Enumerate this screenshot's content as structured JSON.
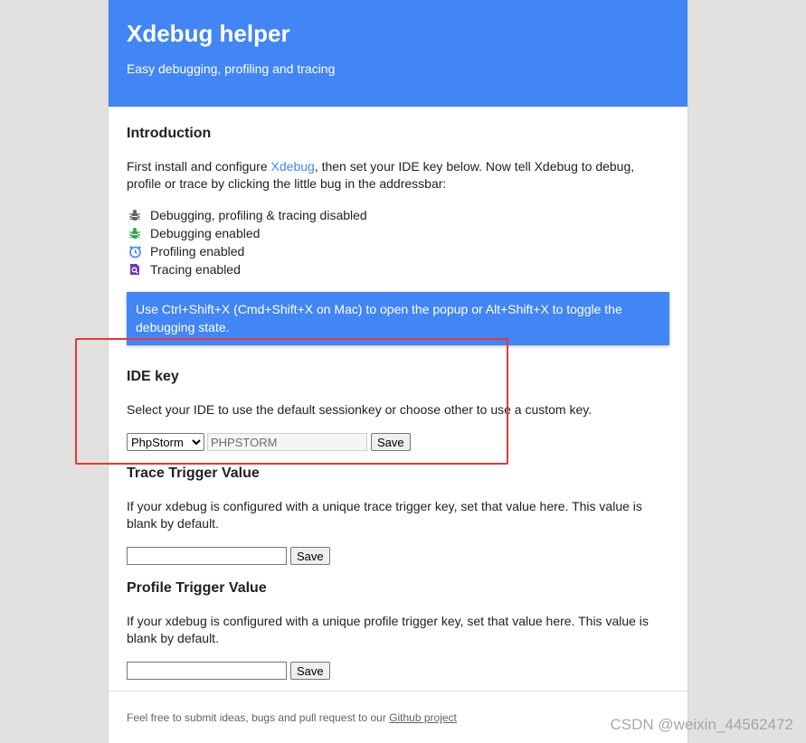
{
  "header": {
    "title": "Xdebug helper",
    "subtitle": "Easy debugging, profiling and tracing"
  },
  "intro": {
    "heading": "Introduction",
    "text_before_link": "First install and configure ",
    "link_text": "Xdebug",
    "text_after_link": ", then set your IDE key below. Now tell Xdebug to debug, profile or trace by clicking the little bug in the addressbar:",
    "legend": [
      {
        "icon": "bug-gray-icon",
        "color": "#5f6368",
        "label": "Debugging, profiling & tracing disabled"
      },
      {
        "icon": "bug-green-icon",
        "color": "#34a853",
        "label": "Debugging enabled"
      },
      {
        "icon": "clock-blue-icon",
        "color": "#4285f4",
        "label": "Profiling enabled"
      },
      {
        "icon": "trace-purple-icon",
        "color": "#673ab7",
        "label": "Tracing enabled"
      }
    ],
    "tip": "Use Ctrl+Shift+X (Cmd+Shift+X on Mac) to open the popup or Alt+Shift+X to toggle the debugging state."
  },
  "ide": {
    "heading": "IDE key",
    "description": "Select your IDE to use the default sessionkey or choose other to use a custom key.",
    "selected": "PhpStorm",
    "key_value": "PHPSTORM",
    "save_label": "Save"
  },
  "trace": {
    "heading": "Trace Trigger Value",
    "description": "If your xdebug is configured with a unique trace trigger key, set that value here. This value is blank by default.",
    "value": "",
    "save_label": "Save"
  },
  "profile": {
    "heading": "Profile Trigger Value",
    "description": "If your xdebug is configured with a unique profile trigger key, set that value here. This value is blank by default.",
    "value": "",
    "save_label": "Save"
  },
  "footer": {
    "text": "Feel free to submit ideas, bugs and pull request to our ",
    "link_text": "Github project"
  },
  "watermark": "CSDN @weixin_44562472",
  "colors": {
    "accent": "#4285f4",
    "background": "#e3e1df",
    "highlight_border": "#e53935"
  }
}
